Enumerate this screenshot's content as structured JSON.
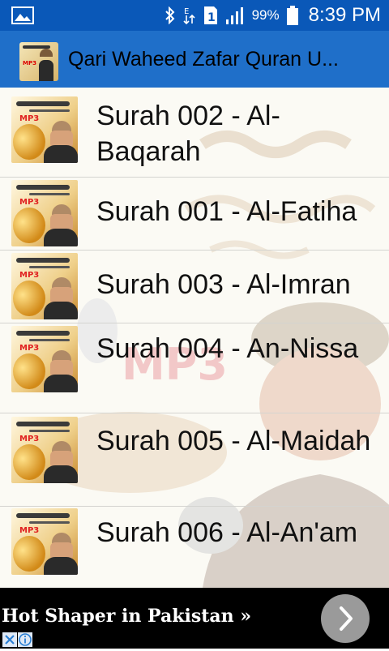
{
  "status_bar": {
    "battery_percent": "99%",
    "time": "8:39 PM",
    "icons": [
      "gallery-icon",
      "bluetooth-icon",
      "data-transfer-icon",
      "sim-1-icon",
      "signal-icon",
      "battery-icon"
    ]
  },
  "action_bar": {
    "title": "Qari Waheed Zafar Quran U...",
    "app_icon": "app-logo-icon"
  },
  "list": {
    "items": [
      {
        "label": "Surah 002 - Al-Baqarah"
      },
      {
        "label": "Surah 001 - Al-Fatiha"
      },
      {
        "label": "Surah 003 - Al-Imran"
      },
      {
        "label": "Surah 004 - An-Nissa"
      },
      {
        "label": "Surah 005 - Al-Maidah"
      },
      {
        "label": "Surah 006 - Al-An'am"
      }
    ],
    "thumb_mp3": "MP3"
  },
  "ad": {
    "text": "Hot Shaper in Pakistan »",
    "arrow_icon": "chevron-right-icon",
    "close_icon": "close-icon",
    "info_icon": "info-icon"
  },
  "colors": {
    "status_bar": "#0a58b8",
    "action_bar": "#1f6fc9",
    "ad_background": "#000000"
  }
}
